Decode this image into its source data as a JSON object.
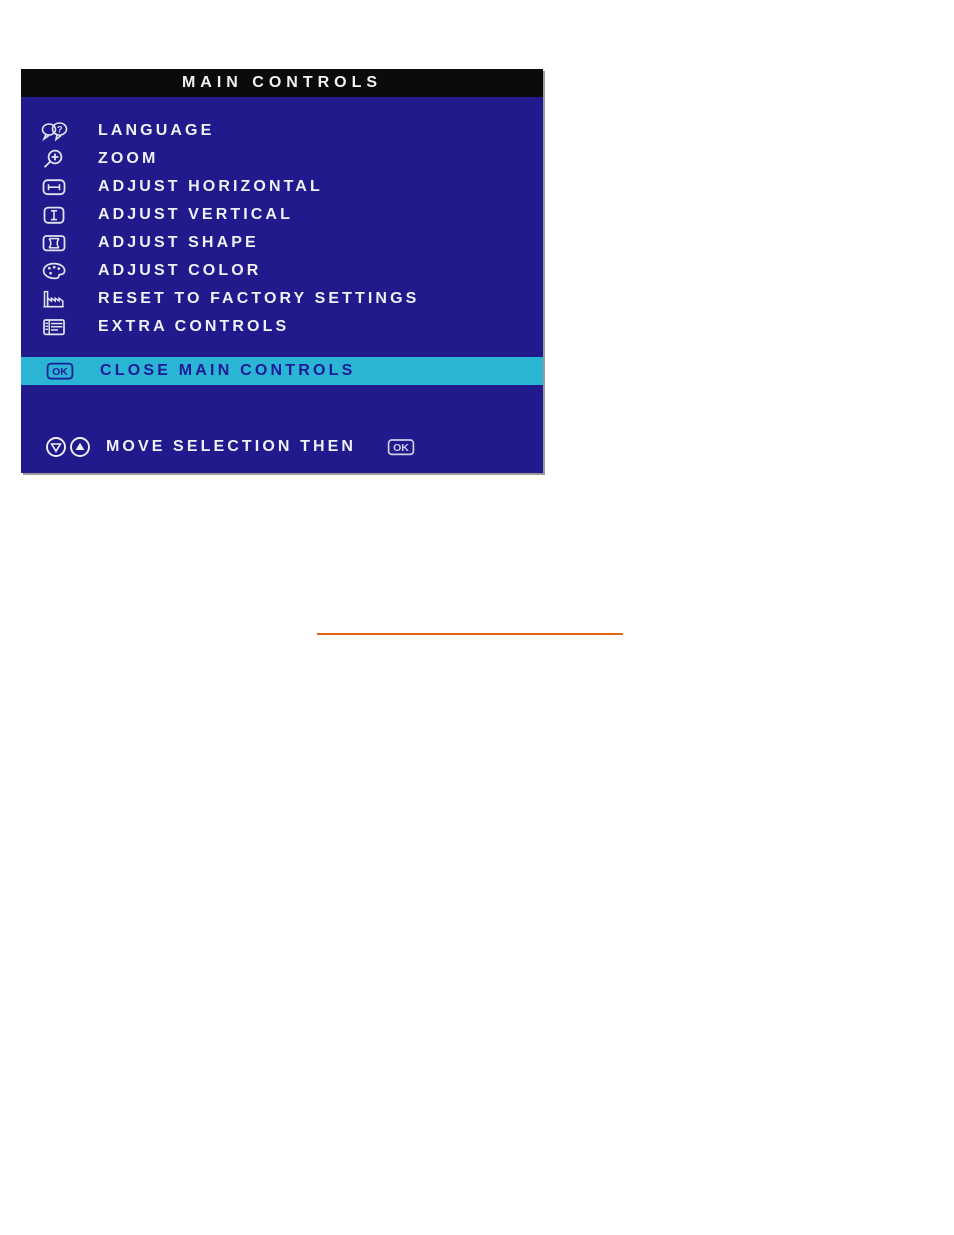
{
  "osd": {
    "title": "MAIN CONTROLS",
    "colors": {
      "panel_background": "#201A8C",
      "titlebar_background": "#0D0A0A",
      "title_text": "#F2F2F2",
      "item_text": "#F0F0F5",
      "highlight_background": "#2BB5D4",
      "highlight_text": "#1C1A96",
      "panel_shadow": "#9A9A9A"
    },
    "menu_items": [
      {
        "icon": "speech-bubbles-icon",
        "label": "LANGUAGE",
        "selected": false
      },
      {
        "icon": "magnifier-plus-icon",
        "label": "ZOOM",
        "selected": false
      },
      {
        "icon": "horizontal-arrows-screen-icon",
        "label": "ADJUST HORIZONTAL",
        "selected": false
      },
      {
        "icon": "vertical-arrows-screen-icon",
        "label": "ADJUST VERTICAL",
        "selected": false
      },
      {
        "icon": "pincushion-screen-icon",
        "label": "ADJUST SHAPE",
        "selected": false
      },
      {
        "icon": "palette-icon",
        "label": "ADJUST COLOR",
        "selected": false
      },
      {
        "icon": "factory-icon",
        "label": "RESET TO FACTORY SETTINGS",
        "selected": false
      },
      {
        "icon": "screen-list-icon",
        "label": "EXTRA CONTROLS",
        "selected": false
      }
    ],
    "selected_item": {
      "icon": "ok-button-icon",
      "label": "CLOSE MAIN CONTROLS"
    },
    "footer": {
      "down_arrow_icon": "circle-down-arrow-icon",
      "up_arrow_icon": "circle-up-arrow-icon",
      "hint": "MOVE SELECTION THEN",
      "confirm_icon": "ok-button-icon"
    }
  },
  "divider": {
    "color": "#E2620E"
  }
}
